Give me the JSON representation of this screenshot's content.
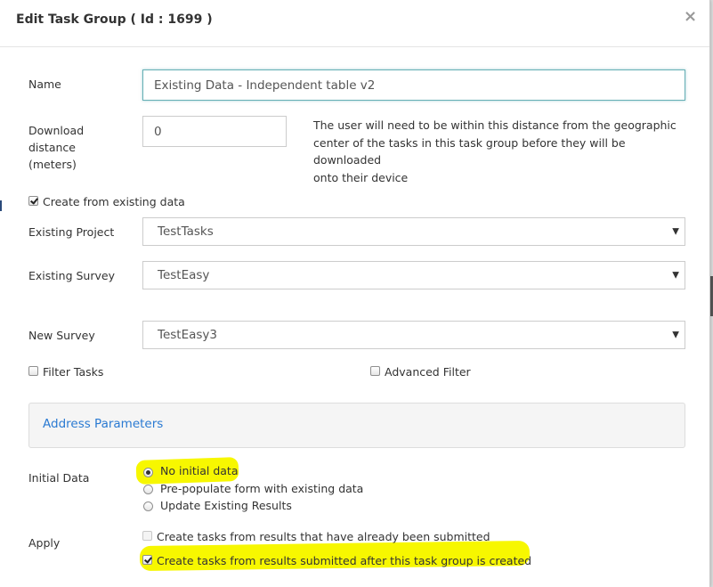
{
  "modal": {
    "title": "Edit Task Group ( Id : 1699 )",
    "close_glyph": "×"
  },
  "form": {
    "name": {
      "label": "Name",
      "value": "Existing Data -  Independent table v2"
    },
    "download_distance": {
      "label_lines": [
        "Download",
        "distance",
        "(meters)"
      ],
      "value": "0",
      "help_lines": [
        "The user will need to be within this distance from the geographic",
        "center of the tasks in this task group before they will be downloaded",
        "onto their device"
      ]
    },
    "create_from_existing": {
      "label": "Create from existing data",
      "checked": true
    },
    "existing_project": {
      "label": "Existing Project",
      "value": "TestTasks"
    },
    "existing_survey": {
      "label": "Existing Survey",
      "value": "TestEasy"
    },
    "new_survey": {
      "label": "New Survey",
      "value": "TestEasy3"
    },
    "filter_tasks": {
      "label": "Filter Tasks",
      "checked": false
    },
    "advanced_filter": {
      "label": "Advanced Filter",
      "checked": false
    },
    "address_parameters": {
      "title": "Address Parameters"
    },
    "initial_data": {
      "label": "Initial Data",
      "options": [
        {
          "label": "No initial data",
          "checked": true
        },
        {
          "label": "Pre-populate form with existing data",
          "checked": false
        },
        {
          "label": "Update Existing Results",
          "checked": false
        }
      ]
    },
    "apply": {
      "label": "Apply",
      "options": [
        {
          "label": "Create tasks from results that have already been submitted",
          "checked": false,
          "disabled": true
        },
        {
          "label": "Create tasks from results submitted after this task group is created",
          "checked": true,
          "disabled": false
        }
      ]
    }
  },
  "colors": {
    "accent_link": "#2a7ad2",
    "highlight": "#f7f700",
    "focus_border": "#66afb5"
  }
}
